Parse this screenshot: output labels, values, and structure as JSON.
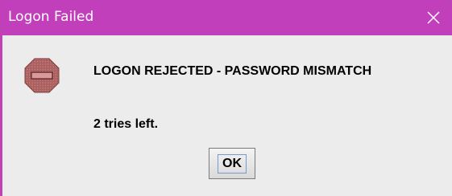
{
  "window": {
    "title": "Logon Failed",
    "close_icon": "close-icon",
    "accent_color": "#c13fbb"
  },
  "dialog": {
    "icon": "stop-sign-icon",
    "message": "LOGON REJECTED - PASSWORD MISMATCH",
    "detail": "2 tries left.",
    "ok_label": "OK"
  }
}
